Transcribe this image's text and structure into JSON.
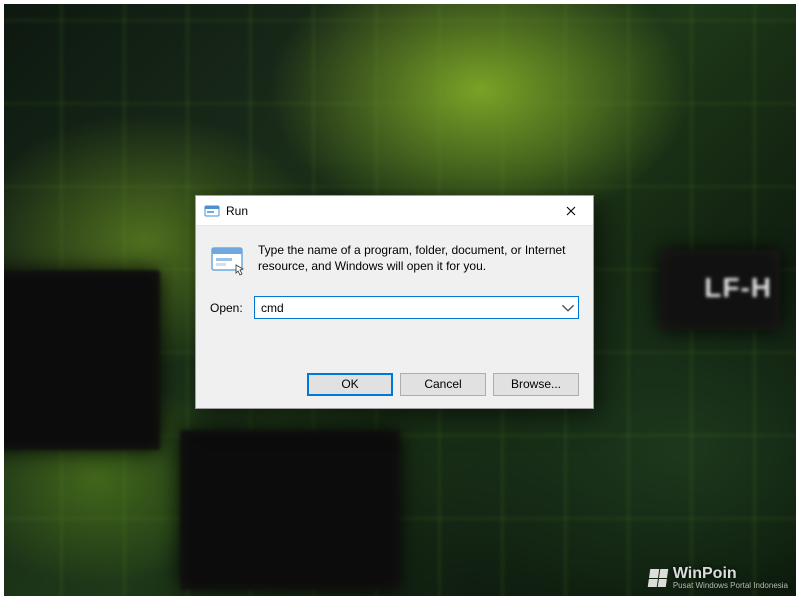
{
  "dialog": {
    "title": "Run",
    "description": "Type the name of a program, folder, document, or Internet resource, and Windows will open it for you.",
    "open_label": "Open:",
    "input_value": "cmd",
    "buttons": {
      "ok": "OK",
      "cancel": "Cancel",
      "browse": "Browse..."
    }
  },
  "watermark": {
    "brand": "WinPoin",
    "tagline": "Pusat Windows Portal Indonesia"
  },
  "bg_chip_text": "LF-H"
}
